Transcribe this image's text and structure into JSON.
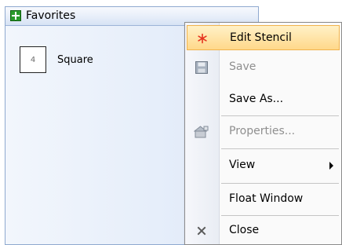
{
  "stencil": {
    "title": "Favorites",
    "shapes": [
      {
        "label": "Square",
        "thumb_text": "4"
      }
    ]
  },
  "context_menu": {
    "items": [
      {
        "label": "Edit Stencil",
        "icon": "asterisk-icon",
        "enabled": true,
        "highlighted": true
      },
      {
        "label": "Save",
        "icon": "floppy-disk-icon",
        "enabled": false
      },
      {
        "label": "Save As...",
        "icon": "",
        "enabled": true
      },
      {
        "label": "Properties...",
        "icon": "properties-icon",
        "enabled": false
      },
      {
        "label": "View",
        "icon": "",
        "enabled": true,
        "submenu": true
      },
      {
        "label": "Float Window",
        "icon": "",
        "enabled": true
      },
      {
        "label": "Close",
        "icon": "close-icon",
        "enabled": true
      }
    ]
  },
  "colors": {
    "highlight": "#ffd88a",
    "highlight_border": "#f1b34c",
    "stencil_icon": "#2a9a2a",
    "disabled_text": "#8f8f8f",
    "asterisk": "#e6331f"
  }
}
